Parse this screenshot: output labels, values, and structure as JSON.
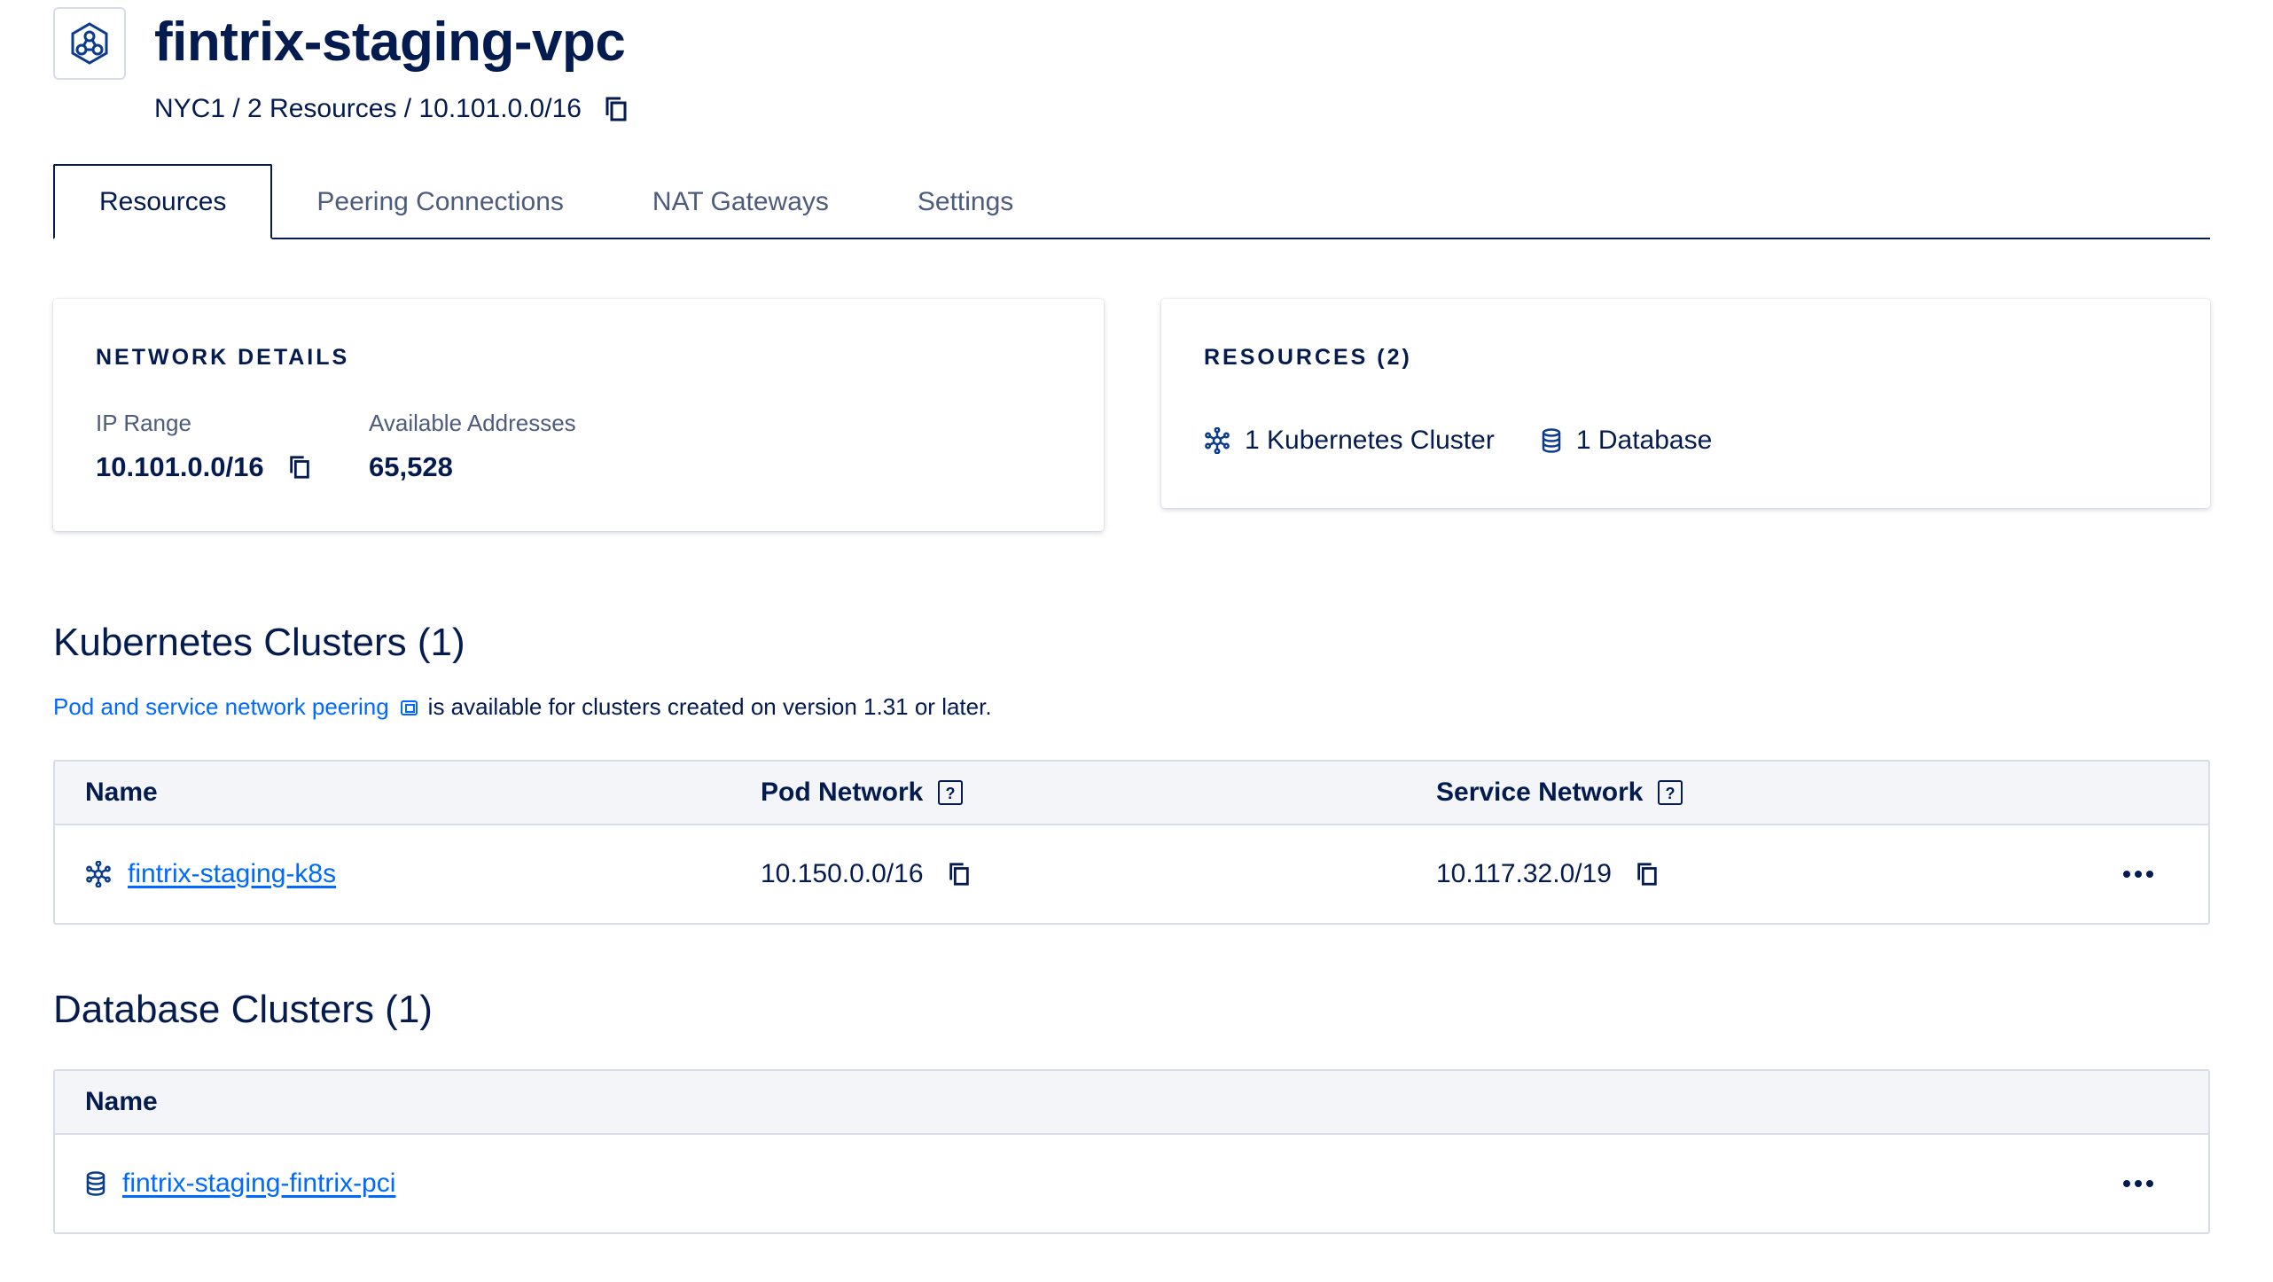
{
  "header": {
    "title": "fintrix-staging-vpc",
    "subtitle": "NYC1 / 2 Resources / 10.101.0.0/16",
    "icon": "vpc-network-icon"
  },
  "tabs": [
    {
      "label": "Resources",
      "active": true
    },
    {
      "label": "Peering Connections",
      "active": false
    },
    {
      "label": "NAT Gateways",
      "active": false
    },
    {
      "label": "Settings",
      "active": false
    }
  ],
  "network_details": {
    "heading": "NETWORK DETAILS",
    "ip_range_label": "IP Range",
    "ip_range_value": "10.101.0.0/16",
    "available_label": "Available Addresses",
    "available_value": "65,528"
  },
  "resources_card": {
    "heading": "RESOURCES (2)",
    "items": [
      {
        "label": "1 Kubernetes Cluster",
        "icon": "kubernetes-icon"
      },
      {
        "label": "1 Database",
        "icon": "database-icon"
      }
    ]
  },
  "kubernetes": {
    "title": "Kubernetes Clusters (1)",
    "note_link": "Pod and service network peering",
    "note_text": "is available for clusters created on version 1.31 or later.",
    "columns": [
      "Name",
      "Pod Network",
      "Service Network"
    ],
    "rows": [
      {
        "name": "fintrix-staging-k8s",
        "pod_network": "10.150.0.0/16",
        "service_network": "10.117.32.0/19"
      }
    ]
  },
  "databases": {
    "title": "Database Clusters (1)",
    "columns": [
      "Name"
    ],
    "rows": [
      {
        "name": "fintrix-staging-fintrix-pci"
      }
    ]
  },
  "colors": {
    "text": "#031b4e",
    "link": "#0069ff",
    "muted": "#4d5b7c",
    "border": "#d8dde8",
    "table_header_bg": "#f3f5f9"
  }
}
